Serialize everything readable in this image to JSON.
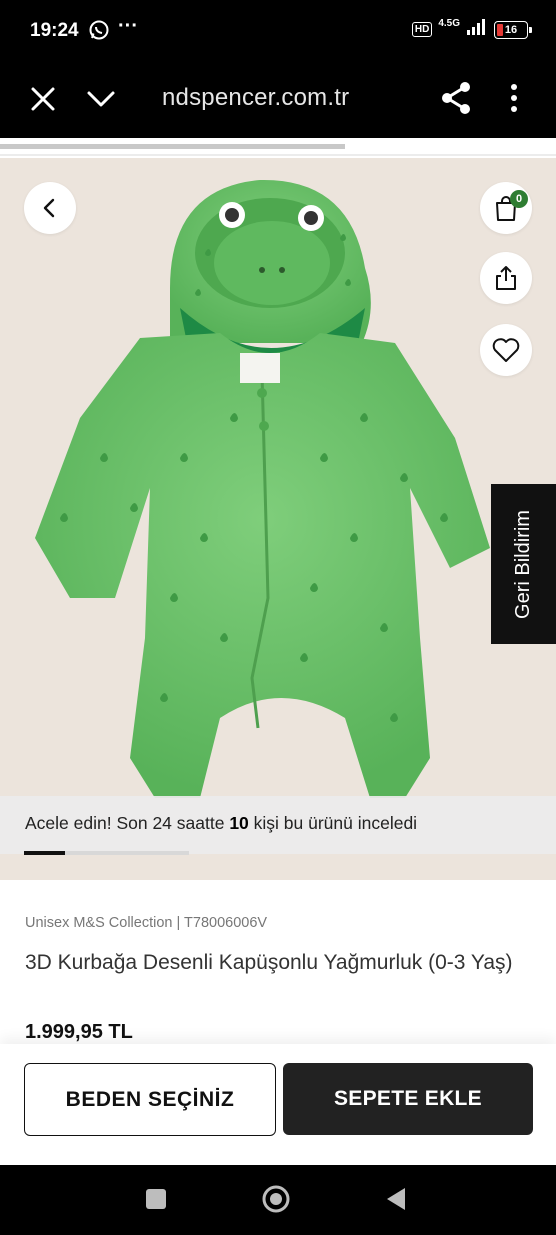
{
  "status_bar": {
    "time": "19:24",
    "more": "···",
    "hd": "HD",
    "network": "4.5G",
    "battery": "16"
  },
  "browser": {
    "url": "ndspencer.com.tr",
    "page_load_progress": 0.62
  },
  "product": {
    "cart_count": "0",
    "feedback_label": "Geri Bildirim",
    "urgency": {
      "prefix": "Acele edin! Son 24 saatte ",
      "count": "10",
      "suffix": " kişi bu ürünü inceledi"
    },
    "gallery_position": 0.25,
    "meta": "Unisex M&S Collection | T78006006V",
    "title": "3D Kurbağa Desenli Kapüşonlu Yağmurluk (0-3 Yaş)",
    "price": "1.999,95 TL"
  },
  "actions": {
    "size_label": "BEDEN SEÇİNİZ",
    "cart_label": "SEPETE EKLE"
  },
  "colors": {
    "accent": "#2e7d32",
    "garment": "#6cc06a",
    "background": "#ece4dc"
  },
  "icons": [
    "whatsapp-icon",
    "close-icon",
    "chevron-down-icon",
    "share-icon",
    "more-vertical-icon",
    "back-icon",
    "shopping-bag-icon",
    "upload-icon",
    "heart-icon"
  ]
}
